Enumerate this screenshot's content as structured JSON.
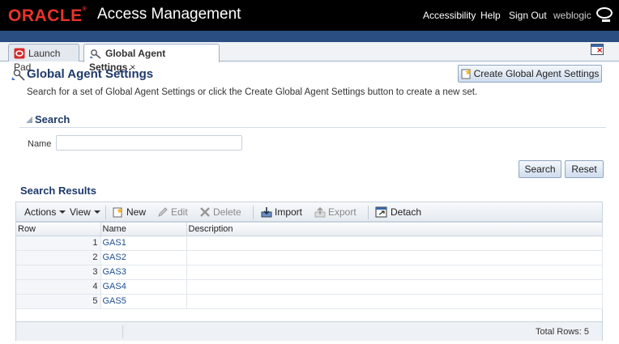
{
  "header": {
    "logo": "ORACLE",
    "app_title": "Access Management",
    "links": [
      "Accessibility",
      "Help",
      "Sign Out"
    ],
    "user": "weblogic"
  },
  "tabs": [
    {
      "label": "Launch Pad",
      "active": false
    },
    {
      "label": "Global Agent Settings",
      "active": true,
      "close": "×"
    }
  ],
  "page": {
    "title": "Global Agent Settings",
    "create_button": "Create Global Agent Settings",
    "description": "Search for a set of Global Agent Settings or click the Create Global Agent Settings button to create a new set."
  },
  "search": {
    "header": "Search",
    "name_label": "Name",
    "name_value": "",
    "search_button": "Search",
    "reset_button": "Reset"
  },
  "results": {
    "header": "Search Results",
    "toolbar": {
      "actions": "Actions",
      "view": "View",
      "new": "New",
      "edit": "Edit",
      "delete": "Delete",
      "import": "Import",
      "export": "Export",
      "detach": "Detach"
    },
    "columns": [
      "Row",
      "Name",
      "Description"
    ],
    "rows": [
      {
        "row": "1",
        "name": "GAS1",
        "description": ""
      },
      {
        "row": "2",
        "name": "GAS2",
        "description": ""
      },
      {
        "row": "3",
        "name": "GAS3",
        "description": ""
      },
      {
        "row": "4",
        "name": "GAS4",
        "description": ""
      },
      {
        "row": "5",
        "name": "GAS5",
        "description": ""
      }
    ],
    "total_rows": "Total Rows:  5"
  },
  "colors": {
    "header_bg": "#000000",
    "band": "#2a4d82",
    "title": "#1e3a6a",
    "link": "#1d4f91"
  },
  "icons": [
    "o-logo-icon",
    "launch-pad-icon",
    "agent-settings-icon",
    "create-icon",
    "new-icon",
    "edit-icon",
    "delete-icon",
    "import-icon",
    "export-icon",
    "detach-icon",
    "detach-window-icon"
  ]
}
